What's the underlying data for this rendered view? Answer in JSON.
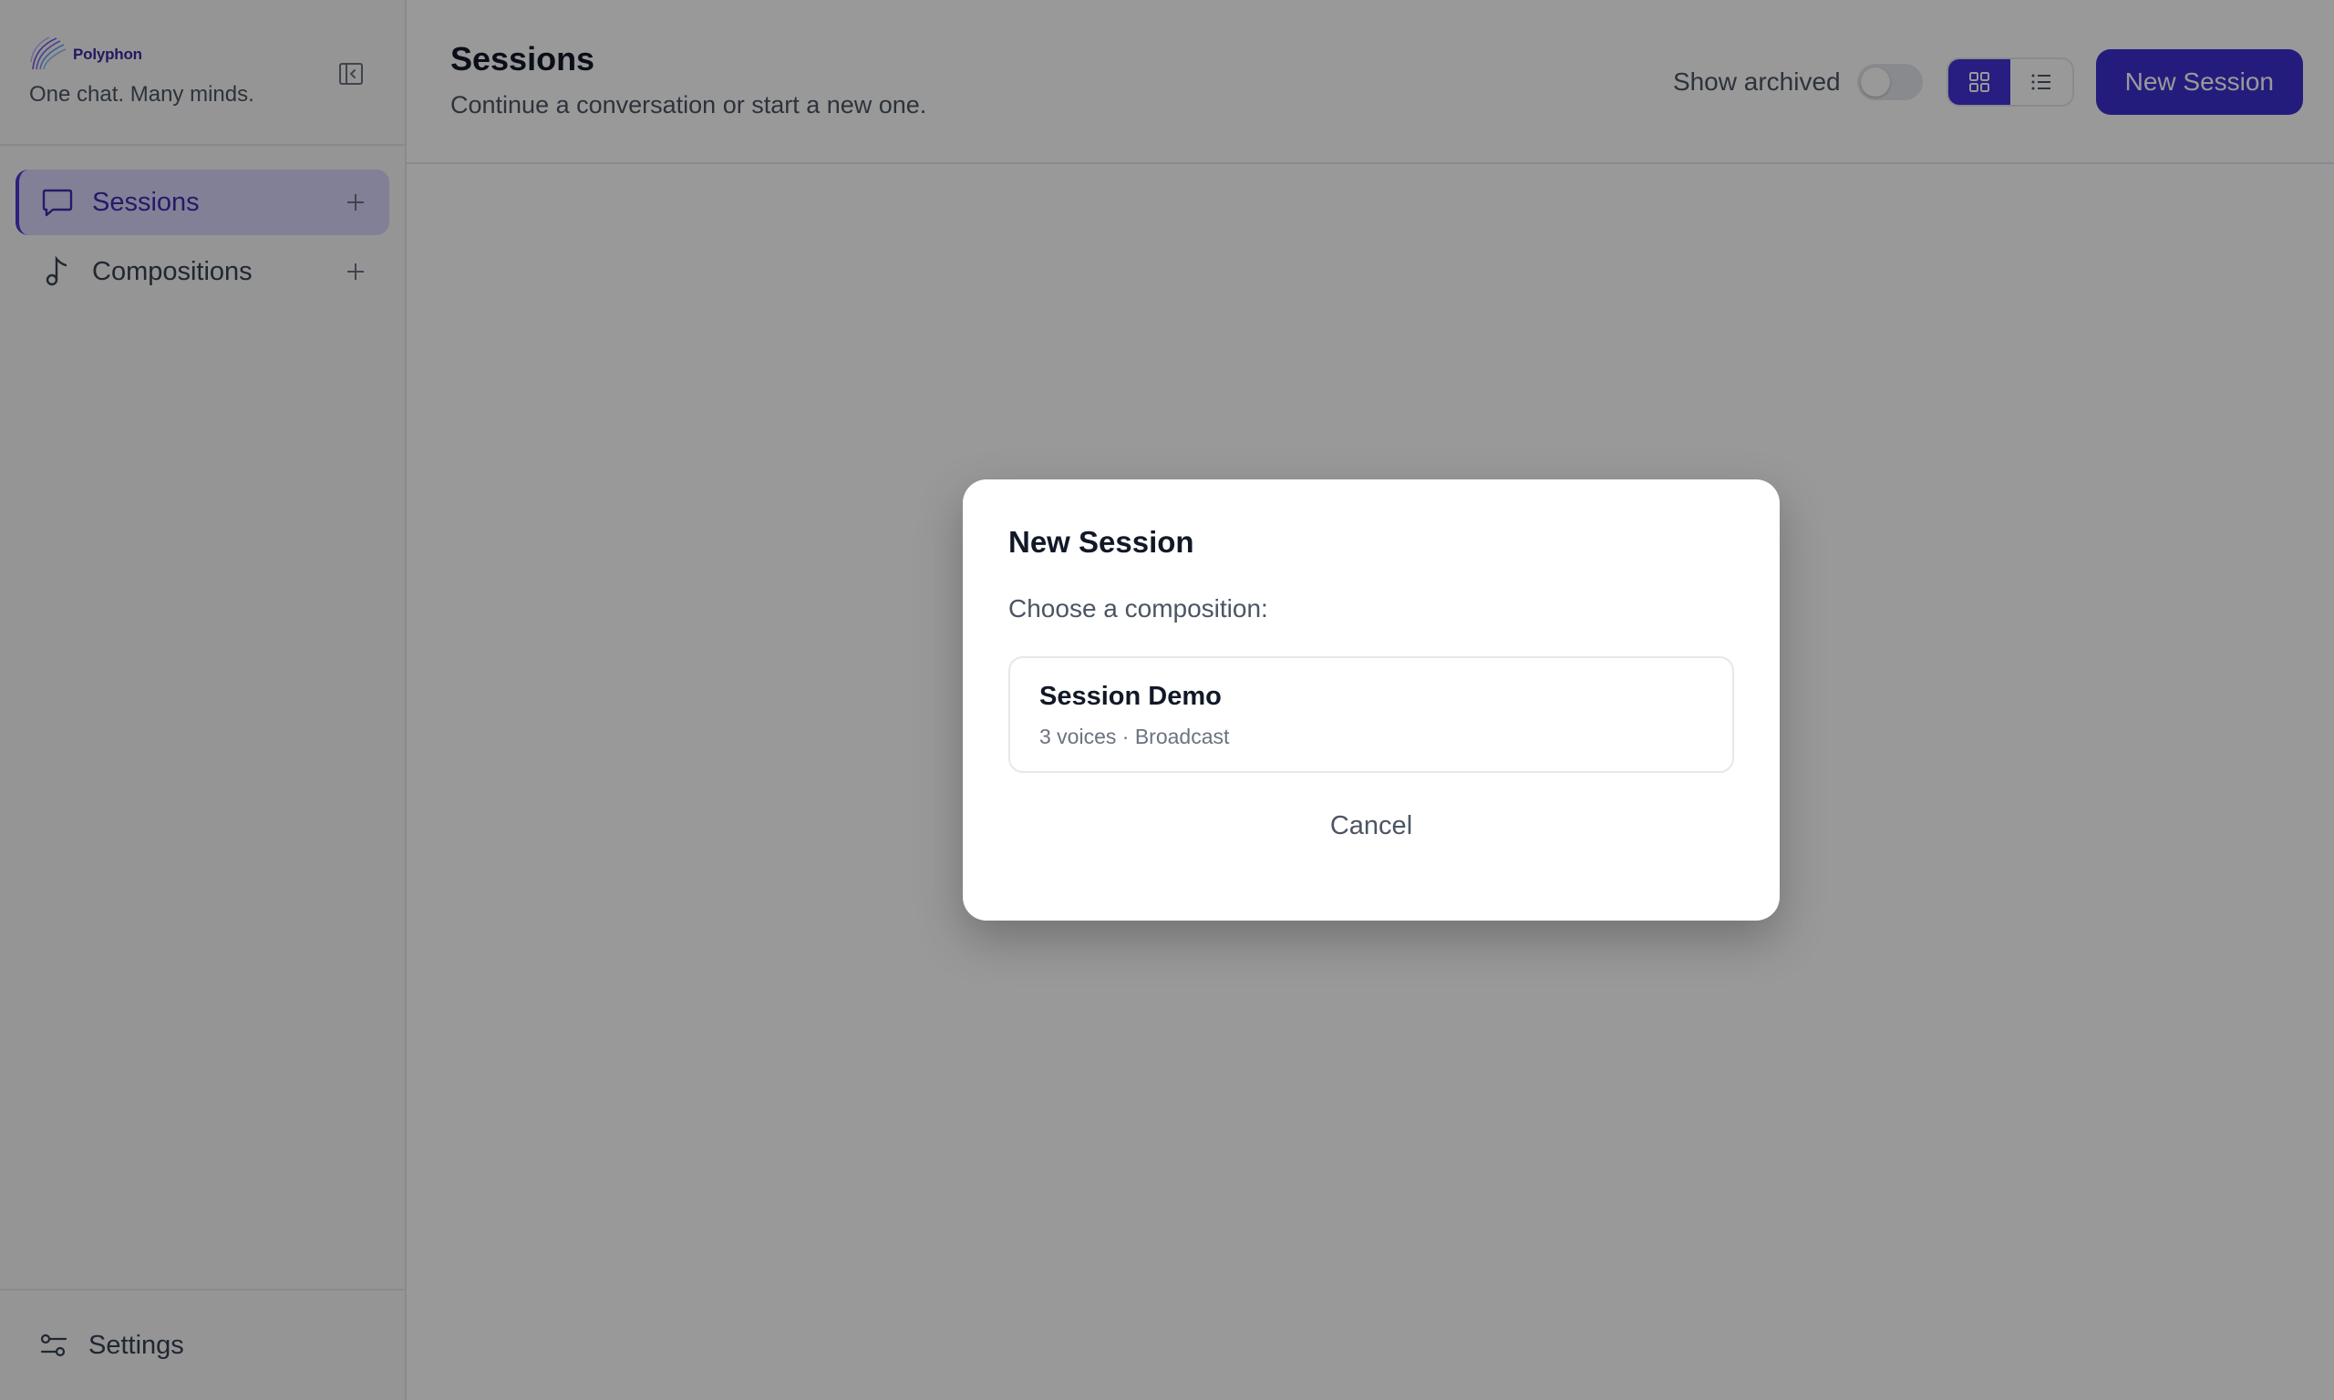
{
  "brand": {
    "name": "Polyphon",
    "tagline": "One chat. Many minds.",
    "accent": "#3d2fd1"
  },
  "sidebar": {
    "items": [
      {
        "label": "Sessions",
        "icon": "chat-bubble-icon",
        "active": true
      },
      {
        "label": "Compositions",
        "icon": "music-note-icon",
        "active": false
      }
    ],
    "footer": {
      "label": "Settings",
      "icon": "sliders-icon"
    }
  },
  "header": {
    "title": "Sessions",
    "subtitle": "Continue a conversation or start a new one.",
    "show_archived_label": "Show archived",
    "show_archived": false,
    "view_mode": "grid",
    "new_session_label": "New Session"
  },
  "modal": {
    "title": "New Session",
    "prompt": "Choose a composition:",
    "compositions": [
      {
        "name": "Session Demo",
        "meta": "3 voices · Broadcast"
      }
    ],
    "cancel_label": "Cancel"
  }
}
